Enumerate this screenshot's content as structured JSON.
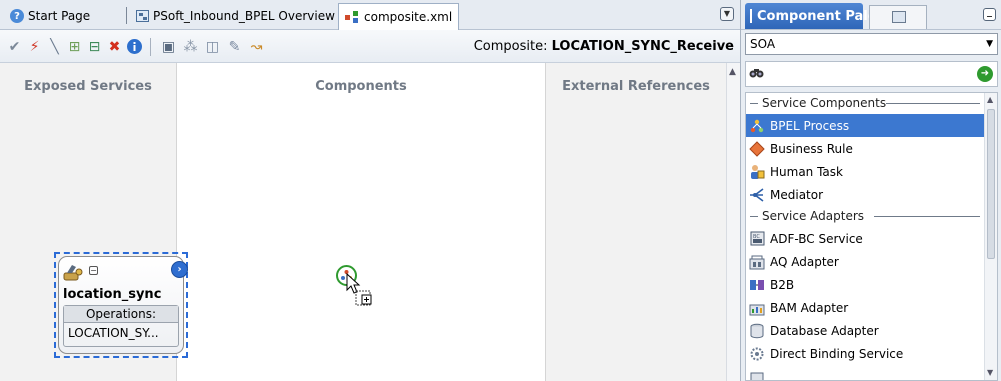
{
  "editor_tabs": [
    {
      "label": "Start Page",
      "icon": "help-icon"
    },
    {
      "label": "PSoft_Inbound_BPEL Overview",
      "icon": "overview-icon"
    },
    {
      "label": "composite.xml",
      "icon": "composite-icon",
      "active": true
    }
  ],
  "toolbar": {
    "composite_prefix": "Composite: ",
    "composite_name": "LOCATION_SYNC_Receive",
    "icons": [
      "validate-icon",
      "wire-icon",
      "line-icon",
      "add-icon",
      "remove-icon",
      "delete-icon",
      "info-icon",
      "deploy-icon",
      "tree-icon",
      "refresh-icon",
      "edit-icon",
      "test-icon"
    ]
  },
  "diagram": {
    "columns": {
      "left": "Exposed Services",
      "middle": "Components",
      "right": "External References"
    },
    "service": {
      "name": "location_sync",
      "operations_label": "Operations:",
      "operation": "LOCATION_SY..."
    }
  },
  "palette": {
    "title": "Component Pale...",
    "category": "SOA",
    "search_value": "",
    "sections": [
      {
        "title": "Service Components",
        "items": [
          {
            "label": "BPEL Process",
            "icon": "bpel-process-icon",
            "selected": true
          },
          {
            "label": "Business Rule",
            "icon": "business-rule-icon"
          },
          {
            "label": "Human Task",
            "icon": "human-task-icon"
          },
          {
            "label": "Mediator",
            "icon": "mediator-icon"
          }
        ]
      },
      {
        "title": "Service Adapters",
        "items": [
          {
            "label": "ADF-BC Service",
            "icon": "adf-bc-icon"
          },
          {
            "label": "AQ Adapter",
            "icon": "aq-adapter-icon"
          },
          {
            "label": "B2B",
            "icon": "b2b-icon"
          },
          {
            "label": "BAM Adapter",
            "icon": "bam-adapter-icon"
          },
          {
            "label": "Database Adapter",
            "icon": "database-adapter-icon"
          },
          {
            "label": "Direct Binding Service",
            "icon": "direct-binding-icon"
          }
        ]
      }
    ]
  },
  "colors": {
    "selection": "#3c78d0",
    "palette_tab": "#2f66b8",
    "drop_ring": "#2f9a2f",
    "service_selection": "#2b6bd6"
  }
}
